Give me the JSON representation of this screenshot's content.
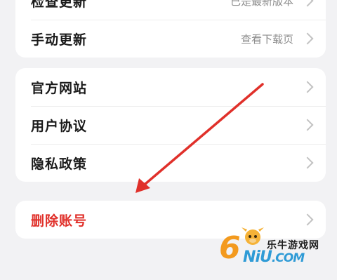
{
  "update_card": {
    "rows": [
      {
        "label": "检查更新",
        "value": "已是最新版本"
      },
      {
        "label": "手动更新",
        "value": "查看下载页"
      }
    ]
  },
  "legal_card": {
    "rows": [
      {
        "label": "官方网站"
      },
      {
        "label": "用户协议"
      },
      {
        "label": "隐私政策"
      }
    ]
  },
  "account_card": {
    "delete_label": "删除账号"
  },
  "annotation": {
    "arrow_color": "#e0302a"
  },
  "watermark": {
    "site_name": "乐牛游戏网",
    "logo_digit": "6",
    "logo_text": "NiU",
    "logo_suffix": ".COM"
  },
  "colors": {
    "background": "#f2f2f4",
    "card": "#ffffff",
    "danger": "#e0302a",
    "secondary_text": "#8c8c8c"
  }
}
